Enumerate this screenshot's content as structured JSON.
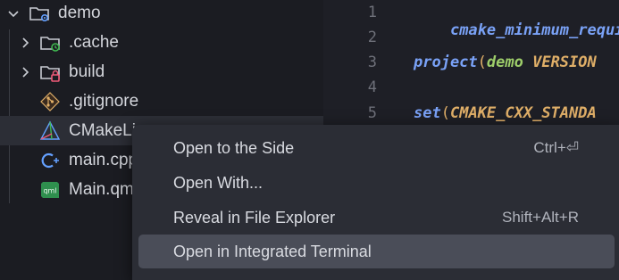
{
  "explorer": {
    "root": {
      "label": "demo",
      "icon": "gear-folder-icon",
      "state": "expanded"
    },
    "items": [
      {
        "label": ".cache",
        "icon": "cache-folder-icon",
        "kind": "folder",
        "accent": "#3fb950"
      },
      {
        "label": "build",
        "icon": "build-folder-icon",
        "kind": "folder",
        "accent": "#f05a78"
      },
      {
        "label": ".gitignore",
        "icon": "git-icon",
        "kind": "file",
        "accent": "#e0af68"
      },
      {
        "label": "CMakeLi",
        "icon": "cmake-icon",
        "kind": "file",
        "accent": "#64a0ff"
      },
      {
        "label": "main.cpp",
        "icon": "cpp-icon",
        "kind": "file",
        "accent": "#64a0ff"
      },
      {
        "label": "Main.qm",
        "icon": "qml-icon",
        "kind": "file",
        "accent": "#3fb950",
        "badge": "qml"
      }
    ]
  },
  "editor": {
    "lines": [
      {
        "number": "1",
        "content": [
          {
            "text": "cmake_minimum_requir",
            "cls": "kw"
          }
        ]
      },
      {
        "number": "2",
        "content": []
      },
      {
        "number": "3",
        "content": [
          {
            "text": "project",
            "cls": "kw"
          },
          {
            "text": "(",
            "cls": "punc"
          },
          {
            "text": "demo ",
            "cls": "arg2"
          },
          {
            "text": "VERSION",
            "cls": "arg"
          }
        ]
      },
      {
        "number": "4",
        "content": []
      },
      {
        "number": "5",
        "content": [
          {
            "text": "set",
            "cls": "kw"
          },
          {
            "text": "(",
            "cls": "punc"
          },
          {
            "text": "CMAKE_CXX_STANDA",
            "cls": "arg"
          }
        ]
      }
    ]
  },
  "context_menu": {
    "items": [
      {
        "label": "Open to the Side",
        "shortcut": "Ctrl+⏎",
        "active": false
      },
      {
        "label": "Open With...",
        "shortcut": "",
        "active": false
      },
      {
        "label": "Reveal in File Explorer",
        "shortcut": "Shift+Alt+R",
        "active": false
      },
      {
        "label": "Open in Integrated Terminal",
        "shortcut": "",
        "active": true
      }
    ]
  },
  "colors": {
    "sidebar_bg": "#1b1c22",
    "editor_bg": "#1e1f26",
    "menu_bg": "#2b2d35",
    "menu_active": "#4a4d58",
    "selection": "#2c2e36"
  }
}
